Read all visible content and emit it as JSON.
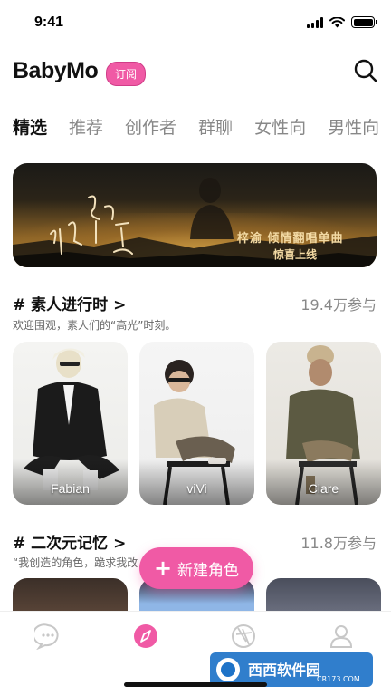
{
  "status_bar": {
    "time": "9:41"
  },
  "header": {
    "brand": "BabyMo",
    "badge": "订阅"
  },
  "tabs": [
    {
      "label": "精选",
      "active": true
    },
    {
      "label": "推荐",
      "active": false
    },
    {
      "label": "创作者",
      "active": false
    },
    {
      "label": "群聊",
      "active": false
    },
    {
      "label": "女性向",
      "active": false
    },
    {
      "label": "男性向",
      "active": false
    }
  ],
  "banner": {
    "title_line1": "梓渝  倾情翻唱单曲",
    "title_line2": "惊喜上线"
  },
  "sections": [
    {
      "title": "#  素人进行时  >",
      "count": "19.4万参与",
      "desc": "欢迎围观，素人们的“高光”时刻。",
      "cards": [
        {
          "label": "Fabian"
        },
        {
          "label": "viVi"
        },
        {
          "label": "Clare"
        }
      ]
    },
    {
      "title": "#  二次元记忆  >",
      "count": "11.8万参与",
      "desc": "“我创造的角色，跪求我改"
    }
  ],
  "fab": {
    "label": "新建角色"
  },
  "watermark": {
    "text": "西西软件园",
    "sub": "CR173.COM"
  },
  "colors": {
    "accent": "#f05aa5",
    "tab_inactive": "#888888"
  },
  "icons": [
    "search-icon",
    "chat-icon",
    "compass-icon",
    "aperture-icon",
    "user-icon"
  ]
}
